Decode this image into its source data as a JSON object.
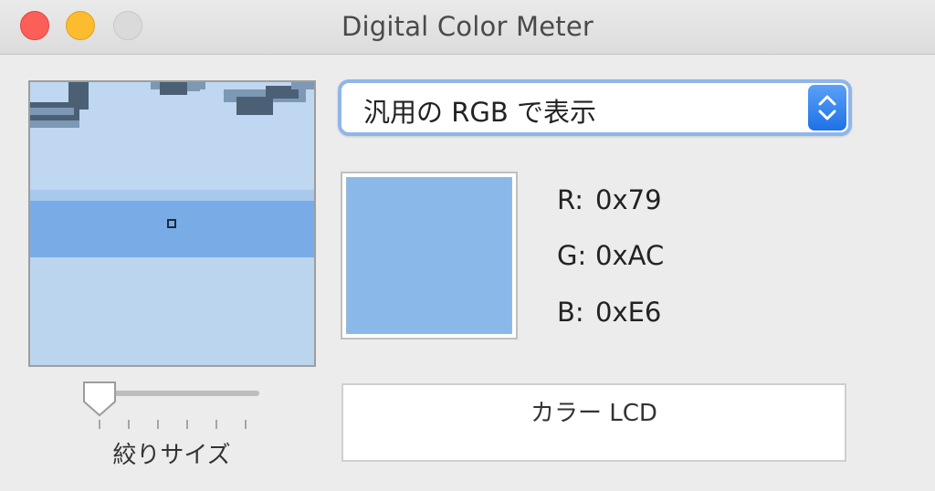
{
  "window": {
    "title": "Digital Color Meter"
  },
  "display_mode": {
    "selected": "汎用の RGB で表示"
  },
  "color": {
    "swatch_hex": "#8ab8e9",
    "r_label": "R:",
    "r_value": "0x79",
    "g_label": "G:",
    "g_value": "0xAC",
    "b_label": "B:",
    "b_value": "0xE6"
  },
  "aperture": {
    "label": "絞りサイズ",
    "level": 0
  },
  "info": {
    "text": "カラー LCD"
  },
  "colors": {
    "close": "#fc5f57",
    "minimize": "#fdbc2e",
    "zoom_inactive": "#dadada",
    "popup_accent": "#1f71e5",
    "focus_ring": "#8fb6ea"
  },
  "icons": {
    "popup_arrows": "up-down-chevron-icon",
    "slider_thumb": "slider-thumb"
  }
}
